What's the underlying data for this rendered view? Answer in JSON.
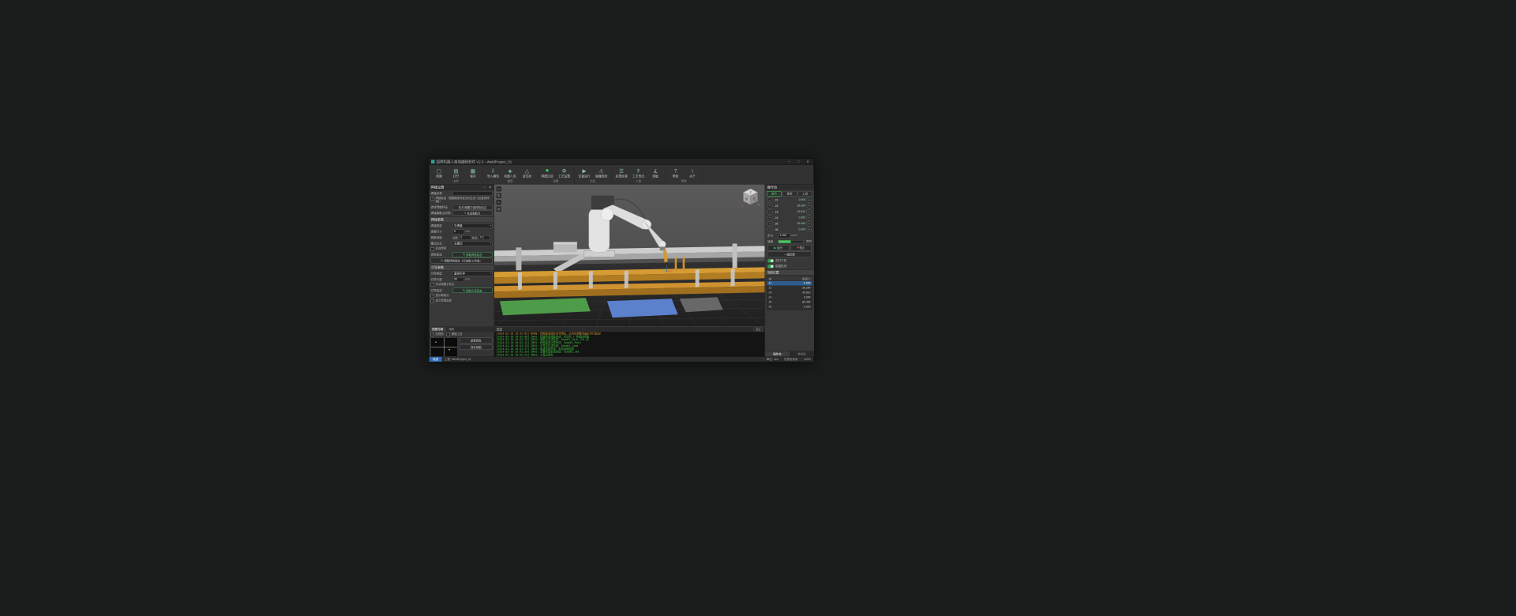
{
  "window": {
    "title": "弧焊机器人离线编程软件 V2.3 - WeldProject_01",
    "minimize": "─",
    "maximize": "□",
    "close": "✕"
  },
  "ribbon": {
    "groups": [
      {
        "caption": "文件",
        "items": [
          {
            "label": "新建",
            "glyph": "▢"
          },
          {
            "label": "打开",
            "glyph": "▤"
          },
          {
            "label": "保存",
            "glyph": "▦"
          }
        ]
      },
      {
        "caption": "模型",
        "items": [
          {
            "label": "导入模型",
            "glyph": "⇩"
          },
          {
            "label": "机器人库",
            "glyph": "◈"
          },
          {
            "label": "变位机",
            "glyph": "△"
          }
        ]
      },
      {
        "caption": "设置",
        "items": [
          {
            "label": "焊缝识别",
            "glyph": "●"
          },
          {
            "label": "工艺设置",
            "glyph": "⚙"
          }
        ]
      },
      {
        "caption": "仿真",
        "items": [
          {
            "label": "仿真运行",
            "glyph": "▶"
          },
          {
            "label": "碰撞检测",
            "glyph": "⚠"
          }
        ]
      },
      {
        "caption": "工具",
        "items": [
          {
            "label": "后置处理",
            "glyph": "☰"
          },
          {
            "label": "工艺导出",
            "glyph": "⇑"
          },
          {
            "label": "测量",
            "glyph": "∡"
          }
        ]
      },
      {
        "caption": "帮助",
        "items": [
          {
            "label": "帮助",
            "glyph": "?"
          },
          {
            "label": "关于",
            "glyph": "i"
          }
        ]
      }
    ]
  },
  "left_panel": {
    "title": "焊缝设置",
    "confirm_icon": "✓",
    "close_icon": "✕",
    "seam_name_label": "焊缝名称",
    "seam_name_value": "",
    "auto_checkbox_label": "焊缝轨迹（根据模型特征自动生成【仅直线焊缝】）",
    "feature_label": "选择焊缝特征",
    "feature_button": "在3D视图中选择特征边",
    "points_label": "焊缝离散点列表",
    "points_button_icon": "≡",
    "points_button": "生成离散点",
    "weld_section": {
      "title": "焊接参数",
      "type_label": "焊缝类型",
      "type_value": "平焊缝",
      "size_label": "焊脚尺寸",
      "size_value": "5",
      "size_unit": "mm",
      "spacing_label": "离散间距",
      "start_label": "间距",
      "start_value": "2",
      "start_unit": "mm",
      "end_label": "弦高",
      "end_value": "0.1",
      "end_unit": "mm",
      "swing_label": "摆动方式",
      "swing_value": "无摆动",
      "reverse_label": "反向焊接",
      "pose_label": "焊枪姿态",
      "pose_button_icon": "↻",
      "pose_button": "获取焊枪姿态",
      "adjust_button_icon": "↻",
      "adjust_button": "调整焊枪姿态（行进角/工作角）"
    },
    "lead_section": {
      "title": "引导参数",
      "type_label": "引导类型",
      "type_value": "直线引导",
      "len_label": "引导长度",
      "len_value": "50",
      "len_unit": "mm",
      "manual_label": "手动调整引导点",
      "pose_label": "引导姿态",
      "pose_button_icon": "↻",
      "pose_button": "获取引导姿态",
      "show_points_label": "显示离散点",
      "show_path_label": "显示焊缝轨迹"
    }
  },
  "layout_panel": {
    "tabs": [
      "视图布局",
      "相机"
    ],
    "checkboxes": [
      "四视图",
      "跟随工具"
    ],
    "buttons": [
      "重置视角",
      "保存视图"
    ]
  },
  "viewport": {
    "tools": [
      {
        "glyph": "⌂"
      },
      {
        "glyph": "↻"
      },
      {
        "glyph": "+"
      },
      {
        "glyph": "◎"
      }
    ],
    "cube_labels": {
      "top": "上",
      "front": "前",
      "right": "右"
    }
  },
  "right_panel": {
    "title": "操作台",
    "modes": [
      "关节",
      "基座",
      "工具"
    ],
    "minus_icon": "−",
    "plus_icon": "+",
    "axes": [
      {
        "label": "J1",
        "value": "0.000"
      },
      {
        "label": "J2",
        "value": "-35.264"
      },
      {
        "label": "J3",
        "value": "42.810"
      },
      {
        "label": "J4",
        "value": "0.000"
      },
      {
        "label": "J5",
        "value": "82.454"
      },
      {
        "label": "J6",
        "value": "0.000"
      }
    ],
    "step_label": "步长",
    "step_value": "1.000",
    "step_unit": "mm/°",
    "speed_label": "速度",
    "speed_value": "50%",
    "run_icon": "▶",
    "run_label": "运行",
    "stop_icon": "■",
    "stop_label": "停止",
    "home_button": "一键回零",
    "toggles": [
      {
        "label": "实时下发"
      },
      {
        "label": "碰撞检测"
      }
    ],
    "position_title": "当前位置",
    "axis_header": "轴",
    "value_header": "数值(°)",
    "pos_rows": [
      {
        "axis": "J1",
        "value": "0.000"
      },
      {
        "axis": "J2",
        "value": "-35.264"
      },
      {
        "axis": "J3",
        "value": "42.810"
      },
      {
        "axis": "J4",
        "value": "0.000"
      },
      {
        "axis": "J5",
        "value": "82.454"
      },
      {
        "axis": "J6",
        "value": "0.000"
      }
    ],
    "tabs": [
      "操作台",
      "坐标系"
    ]
  },
  "log": {
    "title": "日志",
    "clear_button": "清空",
    "entries": [
      {
        "level": "warn",
        "text": "[2024-03-18 16:42:05] WARN: 焊枪姿态接近关节限位，已自动调整至最近可行姿态！"
      },
      {
        "level": "info",
        "text": "[2024-03-18 16:42:08] INFO: 焊缝特征提取完成，共识别 2 条直线焊缝"
      },
      {
        "level": "info",
        "text": "[2024-03-18 16:42:10] INFO: 离散点生成完成：Seam01_Path（36 点）"
      },
      {
        "level": "info",
        "text": "[2024-03-18 16:42:12] INFO: 焊枪姿态计算完成：Seam01_Path"
      },
      {
        "level": "info",
        "text": "[2024-03-18 16:42:15] INFO: 引导点生成完成：Seam01_Lead"
      },
      {
        "level": "info",
        "text": "[2024-03-18 16:42:17] INFO: 轨迹仿真完成，未检测到碰撞"
      },
      {
        "level": "info",
        "text": "[2024-03-18 16:42:20] INFO: 后置代码生成完成：Seam01.JBI"
      },
      {
        "level": "info",
        "text": "[2024-03-18 16:42:23] INFO: 工程已保存"
      }
    ]
  },
  "status_bar": {
    "state": "就绪",
    "project": "工程: WeldProject_01",
    "items": [
      "单位: mm",
      "世界坐标系",
      "100%"
    ]
  }
}
